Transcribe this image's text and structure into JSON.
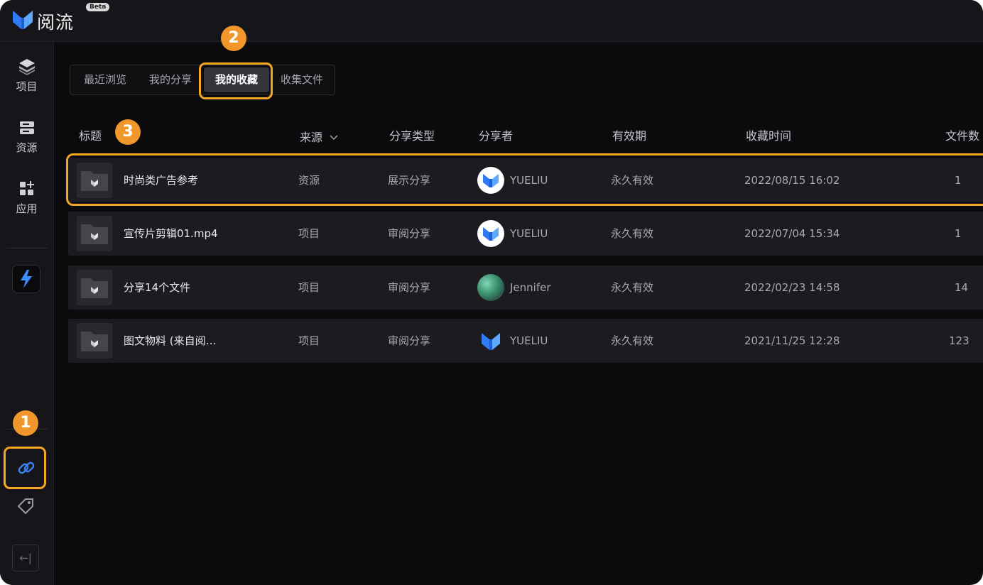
{
  "app": {
    "name": "阅流",
    "beta_label": "Beta"
  },
  "sidebar": {
    "items": [
      {
        "label": "项目",
        "icon": "layers-icon"
      },
      {
        "label": "资源",
        "icon": "storage-icon"
      },
      {
        "label": "应用",
        "icon": "apps-icon"
      }
    ],
    "bottom_icons": [
      "link-icon",
      "tag-icon",
      "collapse-icon"
    ],
    "collapse_glyph": "←|"
  },
  "tabs": [
    {
      "label": "最近浏览",
      "active": false
    },
    {
      "label": "我的分享",
      "active": false
    },
    {
      "label": "我的收藏",
      "active": true
    },
    {
      "label": "收集文件",
      "active": false
    }
  ],
  "table": {
    "headers": {
      "title": "标题",
      "source": "来源",
      "share_type": "分享类型",
      "sharer": "分享者",
      "validity": "有效期",
      "collected_time": "收藏时间",
      "file_count": "文件数"
    },
    "source_sort_icon": "chevron-down-icon",
    "rows": [
      {
        "title": "时尚类广告参考",
        "source": "资源",
        "share_type": "展示分享",
        "sharer": "YUELIU",
        "validity": "永久有效",
        "collected_time": "2022/08/15 16:02",
        "file_count": "1"
      },
      {
        "title": "宣传片剪辑01.mp4",
        "source": "项目",
        "share_type": "审阅分享",
        "sharer": "YUELIU",
        "validity": "永久有效",
        "collected_time": "2022/07/04 15:34",
        "file_count": "1"
      },
      {
        "title": "分享14个文件",
        "source": "项目",
        "share_type": "审阅分享",
        "sharer": "Jennifer",
        "validity": "永久有效",
        "collected_time": "2022/02/23 14:58",
        "file_count": "14"
      },
      {
        "title": "图文物料 (来自阅…",
        "source": "项目",
        "share_type": "审阅分享",
        "sharer": "YUELIU",
        "validity": "永久有效",
        "collected_time": "2021/11/25 12:28",
        "file_count": "123"
      }
    ]
  },
  "annotations": {
    "badge_1": "1",
    "badge_2": "2",
    "badge_3": "3"
  },
  "colors": {
    "accent_orange": "#f5a623",
    "badge_orange": "#f0962a",
    "brand_blue": "#2f7bf5",
    "background": "#0b0b0d"
  }
}
